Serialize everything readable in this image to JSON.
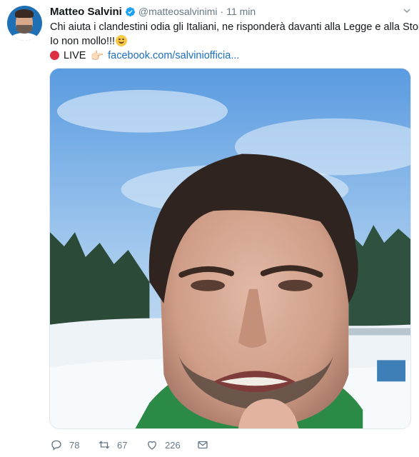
{
  "tweet": {
    "author_name": "Matteo Salvini",
    "handle": "@matteosalvinimi",
    "separator": "·",
    "time": "11 min",
    "text_line_1": "Chi aiuta i clandestini odia gli Italiani, ne risponderà davanti alla Legge e alla Storia.",
    "text_line_2": "Io non mollo!!!",
    "live_label": "LIVE",
    "hand_emoji": "👉🏻",
    "link_text": "facebook.com/salviniofficia..."
  },
  "actions": {
    "replies": "78",
    "retweets": "67",
    "likes": "226"
  },
  "icons": [
    "verified-badge-icon",
    "caret-down-icon",
    "smiling-face-emoji-icon",
    "red-circle-icon",
    "pointing-hand-icon",
    "reply-icon",
    "retweet-icon",
    "like-icon",
    "direct-message-icon"
  ],
  "colors": {
    "accent": "#1da1f2",
    "link": "#1b6ec2",
    "muted": "#657786",
    "live_red": "#dd2e44"
  }
}
